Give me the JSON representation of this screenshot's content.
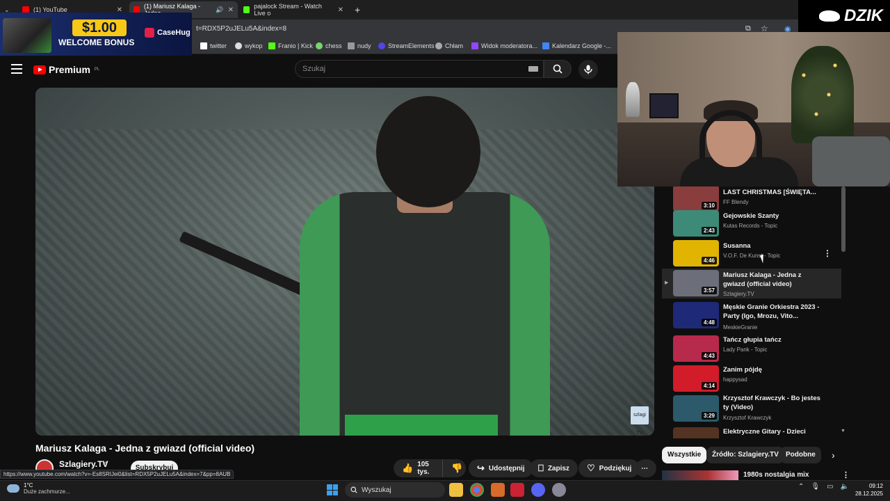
{
  "browser": {
    "tabs": [
      {
        "label": "(1) YouTube",
        "color": "#ff0000"
      },
      {
        "label": "(1) Mariusz Kalaga - Jedna",
        "color": "#ff0000"
      },
      {
        "label": "pajalock Stream - Watch Live o",
        "color": "#53fc18"
      }
    ],
    "url": "t=RDX5P2uJELu5A&index=8",
    "bookmarks": [
      "twitter",
      "wykop",
      "Franio | Kick",
      "chess",
      "nudy",
      "StreamElements",
      "Chłam",
      "Widok moderatora...",
      "Kalendarz Google -..."
    ]
  },
  "ad": {
    "price": "$1.00",
    "bonus": "WELCOME BONUS",
    "brand": "CaseHug"
  },
  "overlay": {
    "brand": "DZIK"
  },
  "youtube": {
    "logo": "Premium",
    "region": "PL",
    "search_placeholder": "Szukaj",
    "video": {
      "title": "Mariusz Kalaga - Jedna z gwiazd (official video)",
      "channel": "Szlagiery.TV",
      "subscribe": "Subskrybuj",
      "likes": "105 tys.",
      "share": "Udostępnij",
      "save": "Zapisz",
      "thanks": "Podziękuj",
      "watermark": "szlagi TV"
    },
    "playlist": [
      {
        "title": "LAST CHRISTMAS [ŚWIĘTA...",
        "channel": "FF Blendy",
        "duration": "3:10",
        "thumb": "#8a3d3d"
      },
      {
        "title": "Gejowskie Szanty",
        "channel": "Kutas Records - Topic",
        "duration": "2:43",
        "thumb": "#3d8a78"
      },
      {
        "title": "Susanna",
        "channel": "V.O.F. De Kunst - Topic",
        "duration": "4:46",
        "thumb": "#e0b400"
      },
      {
        "title": "Mariusz Kalaga - Jedna z gwiazd (official video)",
        "channel": "Szlagiery.TV",
        "duration": "3:57",
        "thumb": "#6c6f7a",
        "current": true
      },
      {
        "title": "Męskie Granie Orkiestra 2023 - Party (Igo, Mrozu, Vito...",
        "channel": "MeskieGranie",
        "duration": "4:48",
        "thumb": "#1e2a78"
      },
      {
        "title": "Tańcz głupia tańcz",
        "channel": "Lady Pank - Topic",
        "duration": "4:43",
        "thumb": "#b82a4c"
      },
      {
        "title": "Zanim pójdę",
        "channel": "happysad",
        "duration": "4:14",
        "thumb": "#d21c2a"
      },
      {
        "title": "Krzysztof Krawczyk - Bo jestes ty (Video)",
        "channel": "Krzysztof Krawczyk",
        "duration": "3:29",
        "thumb": "#2c5a6a"
      },
      {
        "title": "Elektryczne Gitary - Dzieci",
        "channel": "",
        "duration": "",
        "thumb": "#553322"
      }
    ],
    "chips": [
      "Wszystkie",
      "Źródło: Szlagiery.TV",
      "Podobne"
    ],
    "next_title": "1980s nostalgia mix"
  },
  "status_url": "https://www.youtube.com/watch?v=-Es8SRIJei0&list=RDX5P2uJELu5A&index=7&pp=8AUB",
  "taskbar": {
    "temp": "1°C",
    "weather": "Duże zachmurze...",
    "search": "Wyszukaj",
    "time": "09:12",
    "date": "28.12.2025"
  }
}
